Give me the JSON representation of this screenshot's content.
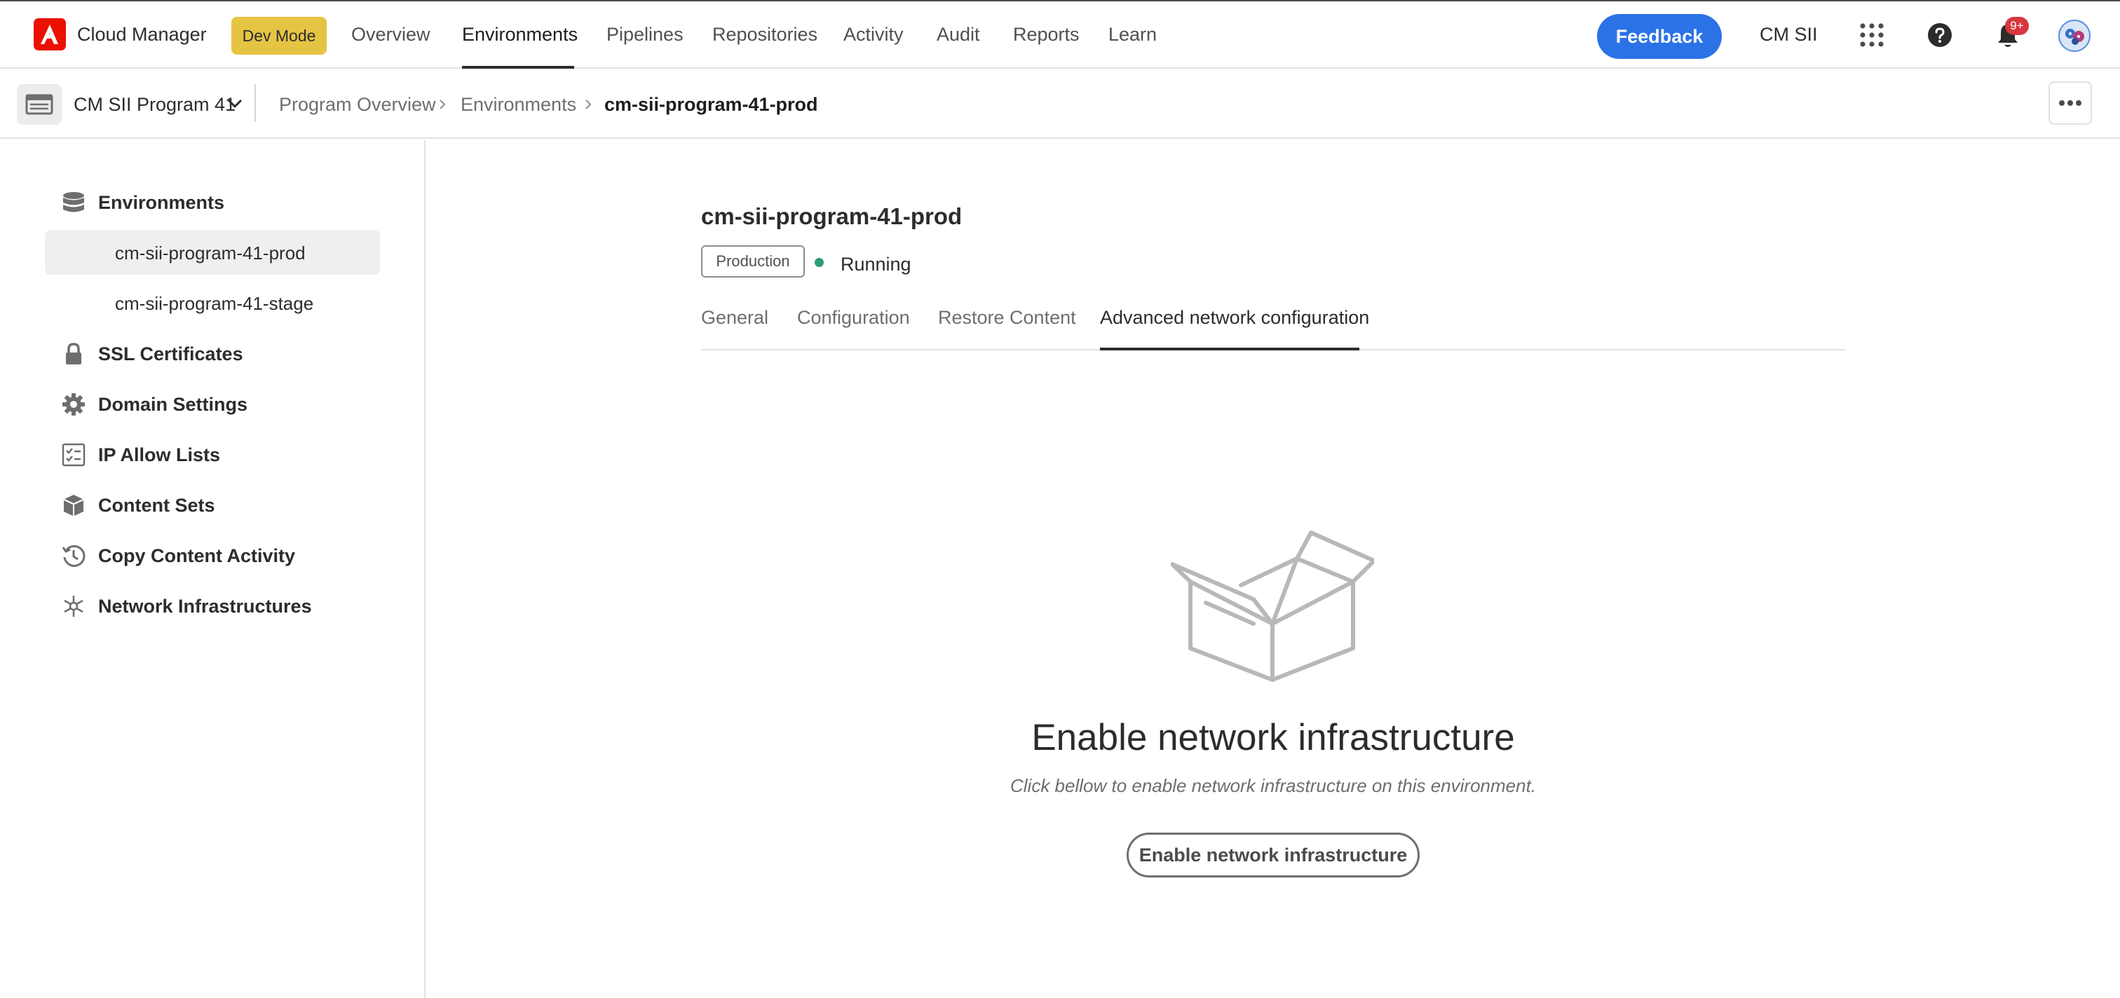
{
  "header": {
    "app_name": "Cloud Manager",
    "dev_mode_label": "Dev Mode",
    "nav": [
      "Overview",
      "Environments",
      "Pipelines",
      "Repositories",
      "Activity",
      "Audit",
      "Reports",
      "Learn"
    ],
    "active_nav": "Environments",
    "feedback_label": "Feedback",
    "org_name": "CM SII",
    "notification_count": "9+",
    "icons": [
      "adobe-logo-icon",
      "apps-grid-icon",
      "help-icon",
      "bell-icon",
      "avatar"
    ],
    "colors": {
      "accent": "#2b72e6",
      "dev_mode": "#e6c443",
      "brand": "#eb1000",
      "badge": "#d7373f"
    }
  },
  "subbar": {
    "program_name": "CM SII Program 41",
    "breadcrumb": [
      "Program Overview",
      "Environments",
      "cm-sii-program-41-prod"
    ]
  },
  "sidebar": {
    "items": [
      {
        "label": "Environments",
        "icon": "database-icon"
      },
      {
        "label": "SSL Certificates",
        "icon": "lock-icon"
      },
      {
        "label": "Domain Settings",
        "icon": "gear-icon"
      },
      {
        "label": "IP Allow Lists",
        "icon": "checklist-icon"
      },
      {
        "label": "Content Sets",
        "icon": "boxes-icon"
      },
      {
        "label": "Copy Content Activity",
        "icon": "history-icon"
      },
      {
        "label": "Network Infrastructures",
        "icon": "network-icon"
      }
    ],
    "environments": [
      "cm-sii-program-41-prod",
      "cm-sii-program-41-stage"
    ],
    "selected_environment": "cm-sii-program-41-prod"
  },
  "main": {
    "title": "cm-sii-program-41-prod",
    "tag": "Production",
    "status": "Running",
    "status_color": "#2d9d78",
    "tabs": [
      "General",
      "Configuration",
      "Restore Content",
      "Advanced network configuration"
    ],
    "active_tab": "Advanced network configuration",
    "empty_state": {
      "icon": "open-box-icon",
      "heading": "Enable network infrastructure",
      "subtext": "Click bellow to enable network infrastructure on this environment.",
      "button_label": "Enable network infrastructure"
    }
  }
}
